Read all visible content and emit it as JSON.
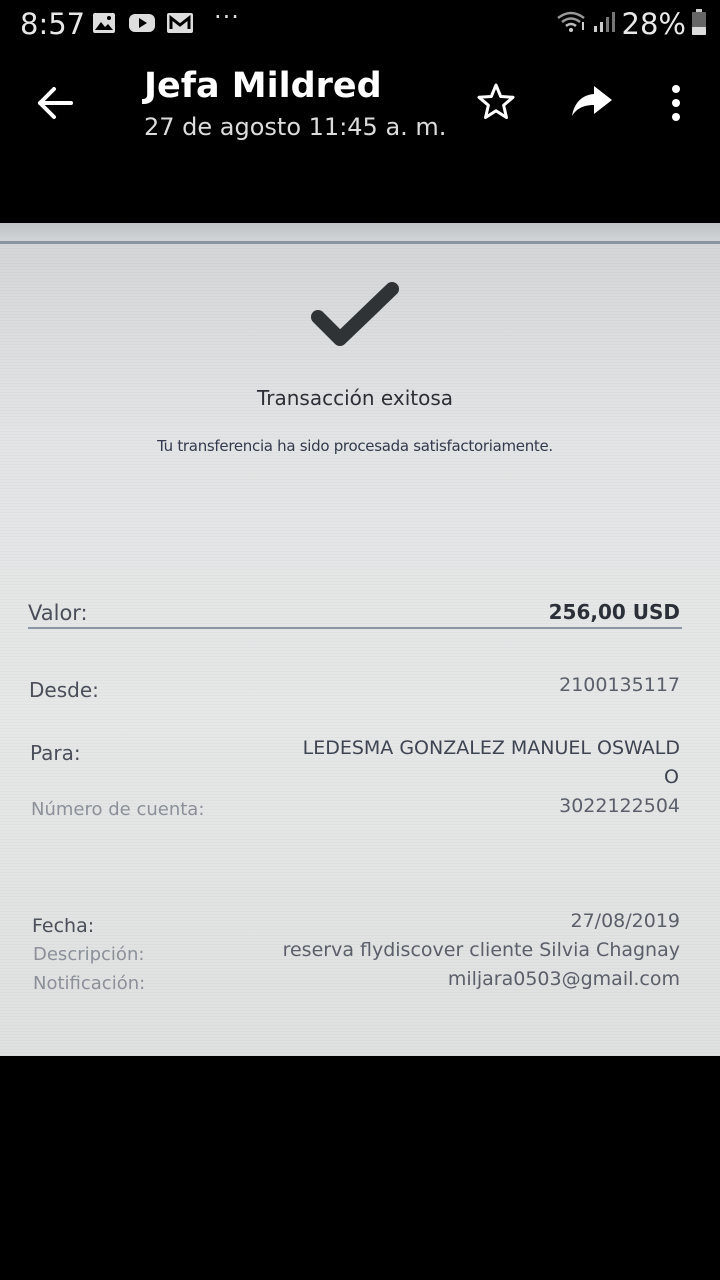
{
  "status_bar": {
    "time": "8:57",
    "battery": "28%",
    "notification_icons": [
      "image-icon",
      "youtube-icon",
      "gmail-icon",
      "more-dots-icon"
    ]
  },
  "header": {
    "title": "Jefa Mildred",
    "subtitle": "27 de agosto 11:45 a. m."
  },
  "receipt": {
    "title": "Transacción exitosa",
    "subtitle": "Tu transferencia ha sido procesada satisfactoriamente.",
    "valor_label": "Valor:",
    "valor": "256,00 USD",
    "desde_label": "Desde:",
    "desde": "2100135117",
    "para_label": "Para:",
    "para_line1": "LEDESMA GONZALEZ MANUEL OSWALD",
    "para_line2": "O",
    "cuenta_label": "Número de cuenta:",
    "cuenta": "3022122504",
    "fecha_label": "Fecha:",
    "fecha": "27/08/2019",
    "descripcion_label": "Descripción:",
    "descripcion": "reserva flydiscover cliente Silvia Chagnay",
    "notificacion_label": "Notificación:",
    "notificacion": "miljara0503@gmail.com"
  }
}
